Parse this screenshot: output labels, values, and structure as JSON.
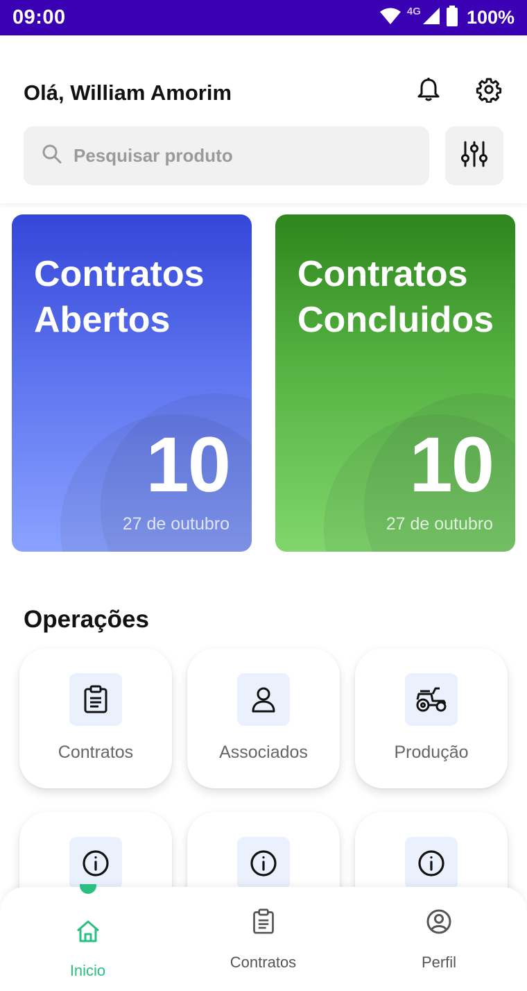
{
  "status_bar": {
    "time": "09:00",
    "network": "4G",
    "battery": "100%"
  },
  "header": {
    "greeting": "Olá, William Amorim",
    "search_placeholder": "Pesquisar produto"
  },
  "cards": [
    {
      "title": "Contratos Abertos",
      "number": "10",
      "date": "27 de outubro",
      "color": "#3446d8"
    },
    {
      "title": "Contratos Concluidos",
      "number": "10",
      "date": "27 de outubro",
      "color": "#2e861c"
    }
  ],
  "operations": {
    "title": "Operações",
    "items": [
      {
        "label": "Contratos",
        "icon": "clipboard-icon"
      },
      {
        "label": "Associados",
        "icon": "user-icon"
      },
      {
        "label": "Produção",
        "icon": "tractor-icon"
      },
      {
        "label": "",
        "icon": "info-icon"
      },
      {
        "label": "",
        "icon": "info-icon"
      },
      {
        "label": "",
        "icon": "info-icon"
      }
    ]
  },
  "bottom_nav": {
    "active_color": "#2bbf84",
    "items": [
      {
        "label": "Inicio",
        "icon": "home-icon",
        "active": true
      },
      {
        "label": "Contratos",
        "icon": "clipboard-icon",
        "active": false
      },
      {
        "label": "Perfil",
        "icon": "user-circle-icon",
        "active": false
      }
    ]
  }
}
